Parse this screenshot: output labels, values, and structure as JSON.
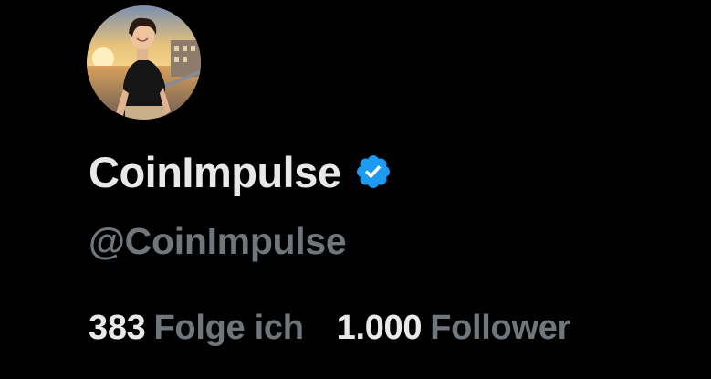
{
  "profile": {
    "display_name": "CoinImpulse",
    "handle": "@CoinImpulse",
    "verified_icon": "verified-badge-icon",
    "avatar_description_icon": "avatar-image",
    "stats": {
      "following_count": "383",
      "following_label": "Folge ich",
      "followers_count": "1.000",
      "followers_label": "Follower"
    },
    "colors": {
      "background": "#000000",
      "primary_text": "#e7e9ea",
      "secondary_text": "#71767b",
      "verified_blue": "#1d9bf0"
    }
  }
}
